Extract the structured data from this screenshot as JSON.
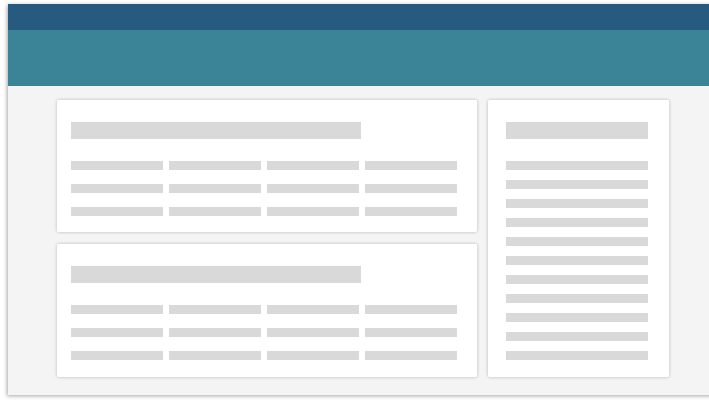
{
  "colors": {
    "topbar": "#265a7f",
    "subbar": "#3b8396",
    "content_bg": "#f4f4f4",
    "card_bg": "#ffffff",
    "placeholder": "#d9d9d9"
  },
  "main_cards": [
    {
      "title_placeholder": "",
      "rows": 3,
      "columns": 4
    },
    {
      "title_placeholder": "",
      "rows": 3,
      "columns": 4
    }
  ],
  "side_card": {
    "title_placeholder": "",
    "lines": 11
  }
}
